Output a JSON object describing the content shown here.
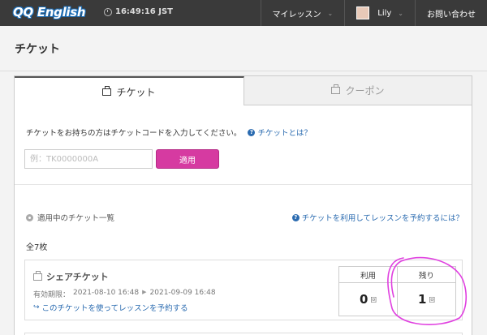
{
  "header": {
    "logo_text": "QQ English",
    "time": "16:49:16 JST",
    "nav": [
      {
        "label": "マイレッスン"
      },
      {
        "label": "Lily"
      },
      {
        "label": "お問い合わせ"
      }
    ]
  },
  "page": {
    "title": "チケット"
  },
  "tabs": [
    {
      "label": "チケット",
      "active": true
    },
    {
      "label": "クーポン",
      "active": false
    }
  ],
  "redeem": {
    "instruction": "チケットをお持ちの方はチケットコードを入力してください。",
    "help_link": "チケットとは？",
    "input_value": "",
    "placeholder": "例：TK0000000A",
    "apply_label": "適用"
  },
  "list": {
    "heading": "適用中のチケット一覧",
    "help_link": "チケットを利用してレッスンを予約するには？",
    "total": "全7枚"
  },
  "tickets": [
    {
      "name": "シェアチケット",
      "valid_label": "有効期限：",
      "valid_from": "2021-08-10 16:48",
      "valid_to": "2021-09-09 16:48",
      "book_link": "このチケットを使ってレッスンを予約する",
      "used_label": "利用",
      "used_value": "0",
      "remaining_label": "残り",
      "remaining_value": "1",
      "unit": "回"
    }
  ],
  "colors": {
    "topbar": "#3a3a3a",
    "accent": "#d63aa1",
    "link": "#2a6bb0",
    "annotation": "#e040e0"
  }
}
